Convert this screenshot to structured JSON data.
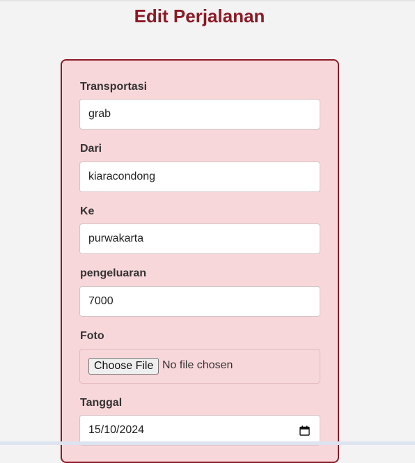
{
  "page": {
    "title": "Edit Perjalanan"
  },
  "form": {
    "transportasi": {
      "label": "Transportasi",
      "value": "grab"
    },
    "dari": {
      "label": "Dari",
      "value": "kiaracondong"
    },
    "ke": {
      "label": "Ke",
      "value": "purwakarta"
    },
    "pengeluaran": {
      "label": "pengeluaran",
      "value": "7000"
    },
    "foto": {
      "label": "Foto",
      "button": "Choose File",
      "status": "No file chosen"
    },
    "tanggal": {
      "label": "Tanggal",
      "value": "15/10/2024",
      "icon": "calendar-icon"
    }
  },
  "colors": {
    "accent": "#8b1a25",
    "card_background": "#f8d7da",
    "page_background": "#f3f3f3"
  }
}
